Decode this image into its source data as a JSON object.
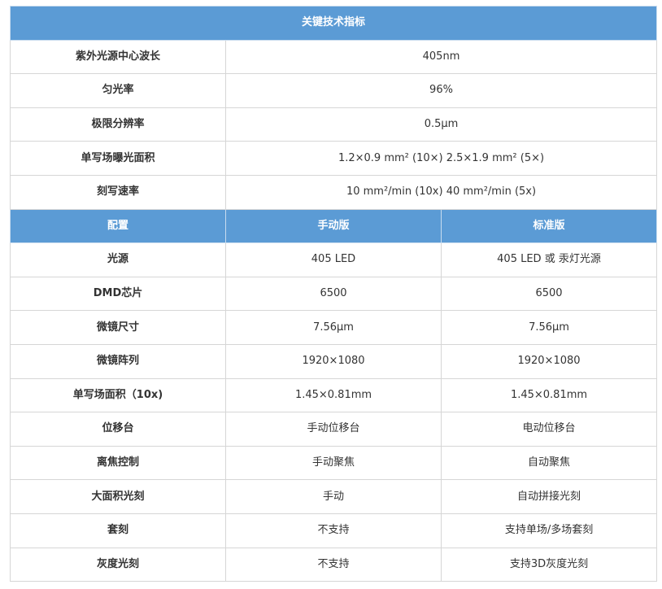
{
  "specs": {
    "title": "关键技术指标",
    "rows": [
      {
        "label": "紫外光源中心波长",
        "value": "405nm"
      },
      {
        "label": "匀光率",
        "value": "96%"
      },
      {
        "label": "极限分辨率",
        "value": "0.5μm"
      },
      {
        "label": "单写场曝光面积",
        "value": "1.2×0.9 mm² (10×) 2.5×1.9 mm² (5×)"
      },
      {
        "label": "刻写速率",
        "value": "10 mm²/min (10x) 40 mm²/min (5x)"
      }
    ]
  },
  "config": {
    "headers": [
      "配置",
      "手动版",
      "标准版"
    ],
    "rows": [
      {
        "label": "光源",
        "manual": "405 LED",
        "standard": "405 LED 或 汞灯光源"
      },
      {
        "label": "DMD芯片",
        "manual": "6500",
        "standard": "6500"
      },
      {
        "label": "微镜尺寸",
        "manual": "7.56μm",
        "standard": "7.56μm"
      },
      {
        "label": "微镜阵列",
        "manual": "1920×1080",
        "standard": "1920×1080"
      },
      {
        "label": "单写场面积（10x)",
        "manual": "1.45×0.81mm",
        "standard": "1.45×0.81mm"
      },
      {
        "label": "位移台",
        "manual": "手动位移台",
        "standard": "电动位移台"
      },
      {
        "label": "离焦控制",
        "manual": "手动聚焦",
        "standard": "自动聚焦"
      },
      {
        "label": "大面积光刻",
        "manual": "手动",
        "standard": "自动拼接光刻"
      },
      {
        "label": "套刻",
        "manual": "不支持",
        "standard": "支持单场/多场套刻"
      },
      {
        "label": "灰度光刻",
        "manual": "不支持",
        "standard": "支持3D灰度光刻"
      }
    ]
  },
  "colors": {
    "header_bg": "#5b9bd5",
    "header_text": "#ffffff",
    "border": "#d6d6d6"
  }
}
